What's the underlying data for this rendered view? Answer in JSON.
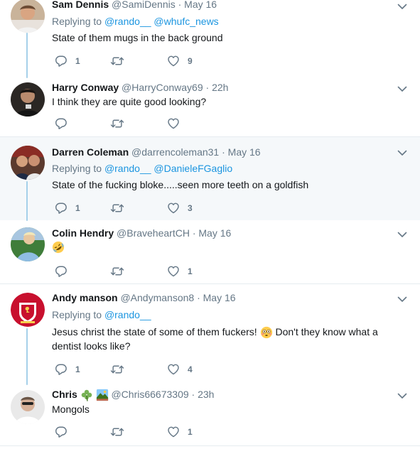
{
  "tweets": [
    {
      "name": "Sam Dennis",
      "handle": "@SamiDennis",
      "time": "May 16",
      "replying_prefix": "Replying to",
      "replying_to": [
        "@rando__",
        "@whufc_news"
      ],
      "text": "State of them mugs in the back ground",
      "replies": "1",
      "retweets": "",
      "likes": "9"
    },
    {
      "name": "Harry Conway",
      "handle": "@HarryConway69",
      "time": "22h",
      "text": "I think they are quite good looking?",
      "replies": "",
      "retweets": "",
      "likes": ""
    },
    {
      "name": "Darren Coleman",
      "handle": "@darrencoleman31",
      "time": "May 16",
      "replying_prefix": "Replying to",
      "replying_to": [
        "@rando__",
        "@DanieleFGaglio"
      ],
      "text": "State of the fucking bloke.....seen more teeth on a goldfish",
      "replies": "1",
      "retweets": "",
      "likes": "3"
    },
    {
      "name": "Colin Hendry",
      "handle": "@BraveheartCH",
      "time": "May 16",
      "text": "",
      "emoji": "rolling-on-floor-laughing-emoji",
      "replies": "",
      "retweets": "",
      "likes": "1"
    },
    {
      "name": "Andy manson",
      "handle": "@Andymanson8",
      "time": "May 16",
      "replying_prefix": "Replying to",
      "replying_to": [
        "@rando__"
      ],
      "text_1": "Jesus christ the state of some of them fuckers!",
      "text_2": "Don't they know what a",
      "text_3": "dentist looks like?",
      "emoji": "flushed-face-emoji",
      "replies": "1",
      "retweets": "",
      "likes": "4"
    },
    {
      "name": "Chris",
      "handle": "@Chris66673309",
      "time": "23h",
      "text": "Mongols",
      "name_emojis": [
        "shamrock-emoji",
        "national-park-emoji"
      ],
      "replies": "",
      "retweets": "",
      "likes": "1"
    }
  ],
  "dot": "·",
  "colors": {
    "link": "#1b95e0",
    "muted": "#657786",
    "thread_line": "#a5d0e9",
    "highlight_bg": "#f5f8fa",
    "separator": "#e6ecf0"
  }
}
